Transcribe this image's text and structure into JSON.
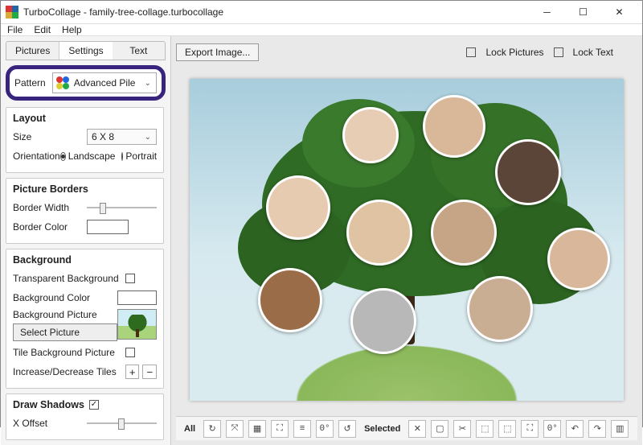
{
  "title": "TurboCollage - family-tree-collage.turbocollage",
  "menu": {
    "file": "File",
    "edit": "Edit",
    "help": "Help"
  },
  "tabs": {
    "pictures": "Pictures",
    "settings": "Settings",
    "text": "Text"
  },
  "pattern": {
    "label": "Pattern",
    "value": "Advanced Pile"
  },
  "layout": {
    "title": "Layout",
    "size_label": "Size",
    "size_value": "6 X 8",
    "orientation_label": "Orientation",
    "landscape": "Landscape",
    "portrait": "Portrait"
  },
  "borders": {
    "title": "Picture Borders",
    "width_label": "Border Width",
    "color_label": "Border Color"
  },
  "background": {
    "title": "Background",
    "transparent_label": "Transparent Background",
    "color_label": "Background Color",
    "picture_label": "Background Picture",
    "select_btn": "Select Picture",
    "tile_label": "Tile Background Picture",
    "inc_dec_label": "Increase/Decrease Tiles"
  },
  "shadows": {
    "title": "Draw Shadows",
    "x_offset": "X Offset"
  },
  "topbar": {
    "export": "Export Image...",
    "lock_pictures": "Lock Pictures",
    "lock_text": "Lock Text"
  },
  "bottombar": {
    "all": "All",
    "selected": "Selected"
  }
}
